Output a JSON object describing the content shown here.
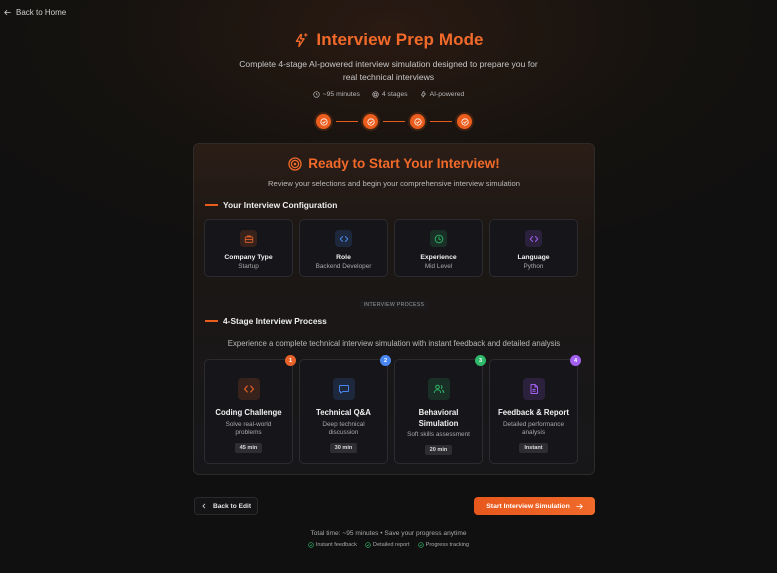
{
  "nav": {
    "back_home": "Back to Home"
  },
  "header": {
    "title": "Interview Prep Mode",
    "subtitle": "Complete 4-stage AI-powered interview simulation designed to prepare you for real technical interviews",
    "meta": {
      "duration": "~95 minutes",
      "stages": "4 stages",
      "ai": "AI-powered"
    }
  },
  "stepper": {
    "completed_steps": 4,
    "total_steps": 4
  },
  "card": {
    "title": "Ready to Start Your Interview!",
    "subtitle": "Review your selections and begin your comprehensive interview simulation",
    "config_heading": "Your Interview Configuration",
    "config": [
      {
        "label": "Company Type",
        "value": "Startup",
        "icon": "briefcase-icon",
        "color": "#e8632a"
      },
      {
        "label": "Role",
        "value": "Backend Developer",
        "icon": "code-icon",
        "color": "#4a86f0"
      },
      {
        "label": "Experience",
        "value": "Mid Level",
        "icon": "clock-icon",
        "color": "#2fb86a"
      },
      {
        "label": "Language",
        "value": "Python",
        "icon": "code-icon",
        "color": "#a25ff0"
      }
    ],
    "divider_label": "INTERVIEW PROCESS",
    "process_heading": "4-Stage Interview Process",
    "process_subtitle": "Experience a complete technical interview simulation with instant feedback and detailed analysis",
    "stages": [
      {
        "num": "1",
        "title": "Coding Challenge",
        "desc": "Solve real-world problems",
        "time": "45 min",
        "icon": "code-icon",
        "color": "#e8632a"
      },
      {
        "num": "2",
        "title": "Technical Q&A",
        "desc": "Deep technical discussion",
        "time": "30 min",
        "icon": "chat-icon",
        "color": "#4a86f0"
      },
      {
        "num": "3",
        "title": "Behavioral Simulation",
        "desc": "Soft skills assessment",
        "time": "20 min",
        "icon": "users-icon",
        "color": "#2fb86a"
      },
      {
        "num": "4",
        "title": "Feedback & Report",
        "desc": "Detailed performance analysis",
        "time": "Instant",
        "icon": "document-icon",
        "color": "#a25ff0"
      }
    ]
  },
  "actions": {
    "back_edit": "Back to Edit",
    "start": "Start Interview Simulation"
  },
  "footer": {
    "total": "Total time: ~95 minutes • Save your progress anytime",
    "features": [
      "Instant feedback",
      "Detailed report",
      "Progress tracking"
    ]
  },
  "colors": {
    "accent": "#ea5d1d",
    "success": "#2fb86a"
  }
}
